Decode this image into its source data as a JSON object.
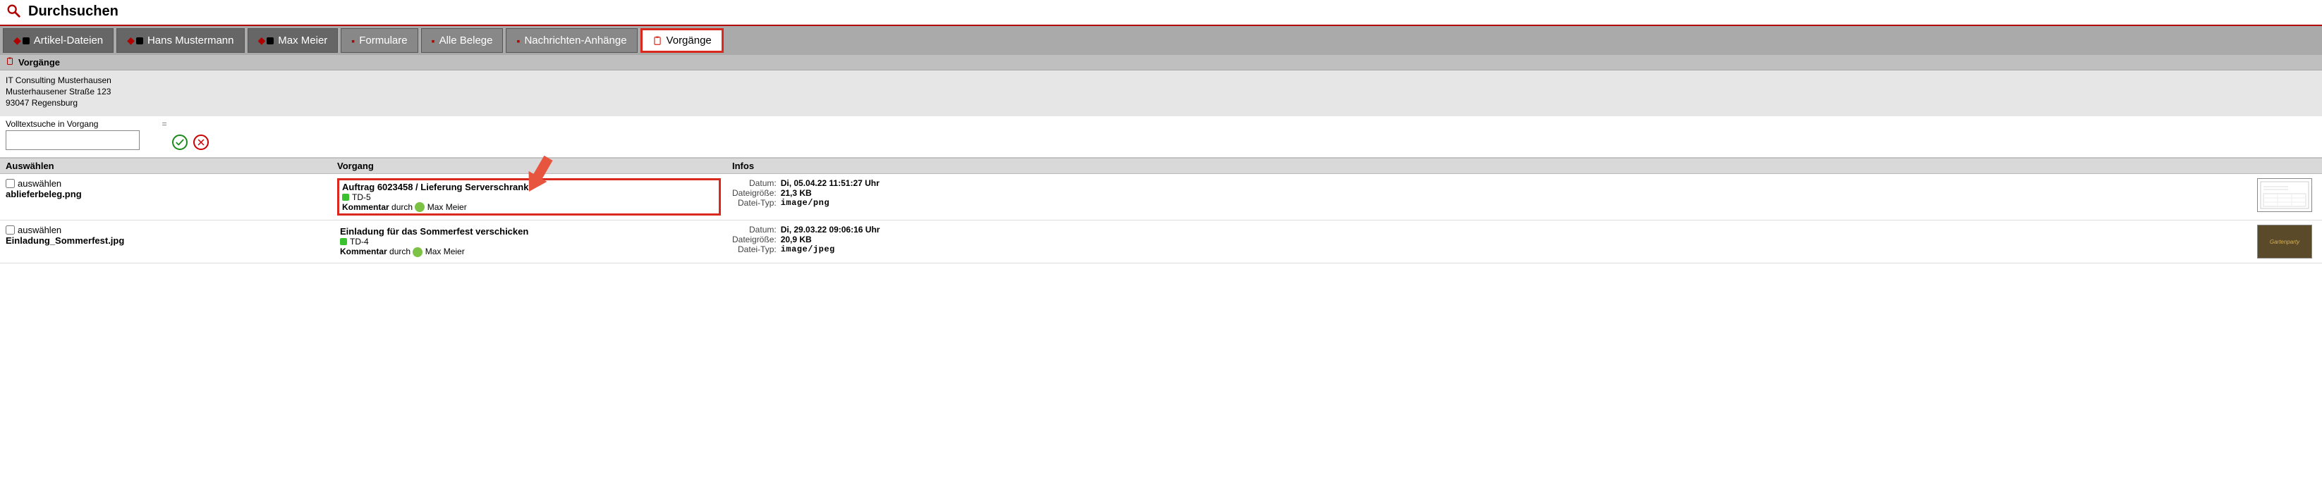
{
  "header": {
    "title": "Durchsuchen"
  },
  "tabs": [
    {
      "label": "Artikel-Dateien",
      "style": "dark",
      "icon": "stack"
    },
    {
      "label": "Hans Mustermann",
      "style": "dark",
      "icon": "stack"
    },
    {
      "label": "Max Meier",
      "style": "dark",
      "icon": "stack"
    },
    {
      "label": "Formulare",
      "style": "light",
      "icon": "small"
    },
    {
      "label": "Alle Belege",
      "style": "light",
      "icon": "small"
    },
    {
      "label": "Nachrichten-Anhänge",
      "style": "light",
      "icon": "small"
    },
    {
      "label": "Vorgänge",
      "style": "active",
      "icon": "clip"
    }
  ],
  "section": {
    "title": "Vorgänge"
  },
  "company": {
    "name": "IT Consulting Musterhausen",
    "street": "Musterhausener Straße 123",
    "city": "93047 Regensburg"
  },
  "search": {
    "label": "Volltextsuche in Vorgang",
    "op": "=",
    "value": ""
  },
  "columns": {
    "select": "Auswählen",
    "vorgang": "Vorgang",
    "infos": "Infos"
  },
  "labels": {
    "select_cb": "auswählen",
    "date": "Datum:",
    "size": "Dateigröße:",
    "type": "Datei-Typ:",
    "comment": "Kommentar",
    "by": "durch"
  },
  "rows": [
    {
      "file": "ablieferbeleg.png",
      "highlight": true,
      "vorgang_title": "Auftrag 6023458 / Lieferung Serverschrank",
      "vorgang_code": "TD-5",
      "comment_user": "Max Meier",
      "date": "Di, 05.04.22 11:51:27 Uhr",
      "size": "21,3 KB",
      "type": "image/png",
      "thumb": "doc"
    },
    {
      "file": "Einladung_Sommerfest.jpg",
      "highlight": false,
      "vorgang_title": "Einladung für das Sommerfest verschicken",
      "vorgang_code": "TD-4",
      "comment_user": "Max Meier",
      "date": "Di, 29.03.22 09:06:16 Uhr",
      "size": "20,9 KB",
      "type": "image/jpeg",
      "thumb": "party"
    }
  ]
}
